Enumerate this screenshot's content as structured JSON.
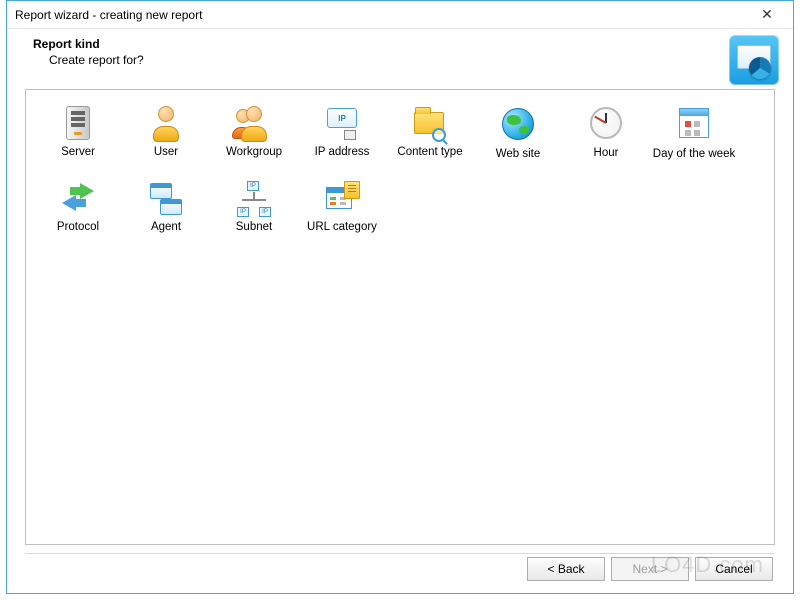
{
  "window": {
    "title": "Report wizard - creating new report"
  },
  "header": {
    "title": "Report kind",
    "subtitle": "Create report for?"
  },
  "items": [
    {
      "key": "server",
      "label": "Server"
    },
    {
      "key": "user",
      "label": "User"
    },
    {
      "key": "workgroup",
      "label": "Workgroup"
    },
    {
      "key": "ip-address",
      "label": "IP address"
    },
    {
      "key": "content-type",
      "label": "Content type"
    },
    {
      "key": "web-site",
      "label": "Web site"
    },
    {
      "key": "hour",
      "label": "Hour"
    },
    {
      "key": "day-of-week",
      "label": "Day of the week"
    },
    {
      "key": "protocol",
      "label": "Protocol"
    },
    {
      "key": "agent",
      "label": "Agent"
    },
    {
      "key": "subnet",
      "label": "Subnet"
    },
    {
      "key": "url-category",
      "label": "URL category"
    }
  ],
  "buttons": {
    "back": "< Back",
    "next": "Next >",
    "cancel": "Cancel"
  },
  "ip_badge": "IP",
  "watermark": "LO4D.com"
}
